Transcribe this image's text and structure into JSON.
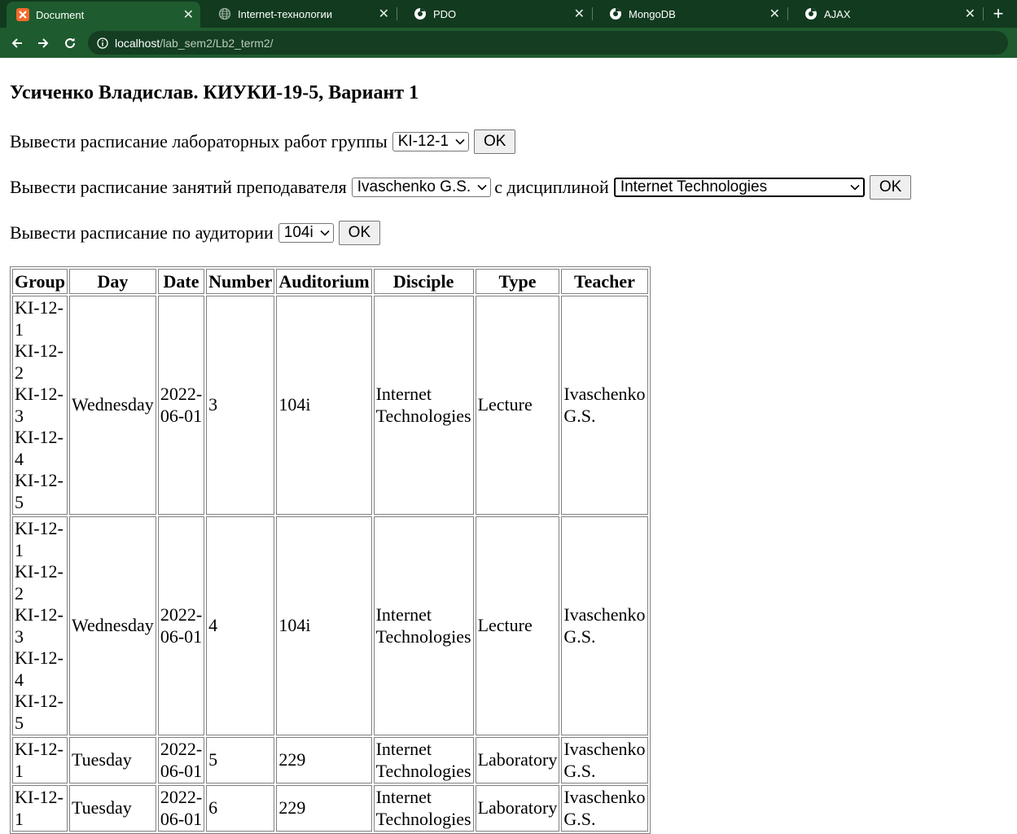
{
  "browser": {
    "tabs": [
      {
        "title": "Document",
        "active": true,
        "icon": "xampp-icon"
      },
      {
        "title": "Internet-технологии",
        "active": false,
        "icon": "globe-icon"
      },
      {
        "title": "PDO",
        "active": false,
        "icon": "chrome-icon"
      },
      {
        "title": "MongoDB",
        "active": false,
        "icon": "chrome-icon"
      },
      {
        "title": "AJAX",
        "active": false,
        "icon": "chrome-icon"
      }
    ],
    "url_host": "localhost",
    "url_path": "/lab_sem2/Lb2_term2/",
    "colors": {
      "tabbar": "#113a1f",
      "toolbar": "#1e5b2e",
      "omnibox": "#143d22",
      "favicon_orange": "#f26b2b"
    }
  },
  "page": {
    "title": "Усиченко Владислав. КИУКИ-19-5, Вариант 1",
    "form_group": {
      "label": "Вывести расписание лабораторных работ группы",
      "selected": "KI-12-1",
      "button": "OK"
    },
    "form_teacher": {
      "label": "Вывести расписание занятий преподавателя",
      "selected": "Ivaschenko G.S.",
      "mid_label": "с дисциплиной",
      "discipline_selected": "Internet Technologies",
      "button": "OK"
    },
    "form_auditorium": {
      "label": "Вывести расписание по аудитории",
      "selected": "104i",
      "button": "OK"
    },
    "table": {
      "headers": [
        "Group",
        "Day",
        "Date",
        "Number",
        "Auditorium",
        "Disciple",
        "Type",
        "Teacher"
      ],
      "rows": [
        {
          "groups": [
            "KI-12-1",
            "KI-12-2",
            "KI-12-3",
            "KI-12-4",
            "KI-12-5"
          ],
          "day": "Wednesday",
          "date": "2022-06-01",
          "number": "3",
          "auditorium": "104i",
          "discipline": "Internet Technologies",
          "type": "Lecture",
          "teacher": "Ivaschenko G.S."
        },
        {
          "groups": [
            "KI-12-1",
            "KI-12-2",
            "KI-12-3",
            "KI-12-4",
            "KI-12-5"
          ],
          "day": "Wednesday",
          "date": "2022-06-01",
          "number": "4",
          "auditorium": "104i",
          "discipline": "Internet Technologies",
          "type": "Lecture",
          "teacher": "Ivaschenko G.S."
        },
        {
          "groups": [
            "KI-12-1"
          ],
          "day": "Tuesday",
          "date": "2022-06-01",
          "number": "5",
          "auditorium": "229",
          "discipline": "Internet Technologies",
          "type": "Laboratory",
          "teacher": "Ivaschenko G.S."
        },
        {
          "groups": [
            "KI-12-1"
          ],
          "day": "Tuesday",
          "date": "2022-06-01",
          "number": "6",
          "auditorium": "229",
          "discipline": "Internet Technologies",
          "type": "Laboratory",
          "teacher": "Ivaschenko G.S."
        }
      ]
    }
  }
}
